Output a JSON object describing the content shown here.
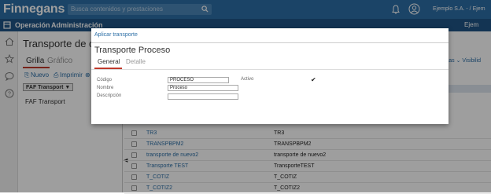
{
  "app": {
    "logo": "Finnegans",
    "search_placeholder": "Busca contenidos y prestaciones",
    "company": "Ejemplo S.A. - / Ejem"
  },
  "menu": {
    "items": [
      "Operación",
      "Administración"
    ],
    "right": "Ejem"
  },
  "page": {
    "title": "Transporte de configuración",
    "tabs": [
      "Grilla",
      "Gráfico"
    ]
  },
  "toolbar": {
    "new": "Nuevo",
    "print": "Imprimir",
    "opts_right": "rtas ⌄  Visibilid"
  },
  "filter": {
    "chip": "FAF Transport ▼"
  },
  "left_list": [
    "FAF Transport"
  ],
  "grid": {
    "rows": [
      {
        "name": "TR3",
        "desc": "TR3"
      },
      {
        "name": "TRANSPBPM2",
        "desc": "TRANSPBPM2"
      },
      {
        "name": "transporte de nuevo2",
        "desc": "transporte de nuevo2"
      },
      {
        "name": "Transporte TEST",
        "desc": "TransporteTEST"
      },
      {
        "name": "T_COTIZ",
        "desc": "T_COTIZ"
      },
      {
        "name": "T_COTIZ2",
        "desc": "T_COTIZ2"
      }
    ]
  },
  "modal": {
    "apply_link": "Aplicar transporte",
    "title": "Transporte Proceso",
    "tabs": {
      "general": "General",
      "detalle": "Detalle"
    },
    "fields": {
      "codigo_label": "Código",
      "codigo_value": "PROCESO",
      "nombre_label": "Nombre",
      "nombre_value": "Proceso",
      "descripcion_label": "Descripción",
      "descripcion_value": "",
      "activo_label": "Activo",
      "activo_checked": "✔"
    }
  },
  "colors": {
    "topbar": "#2d6fa6",
    "menubar": "#1f5486",
    "accent": "#c0392b",
    "link": "#2d6fa6"
  }
}
